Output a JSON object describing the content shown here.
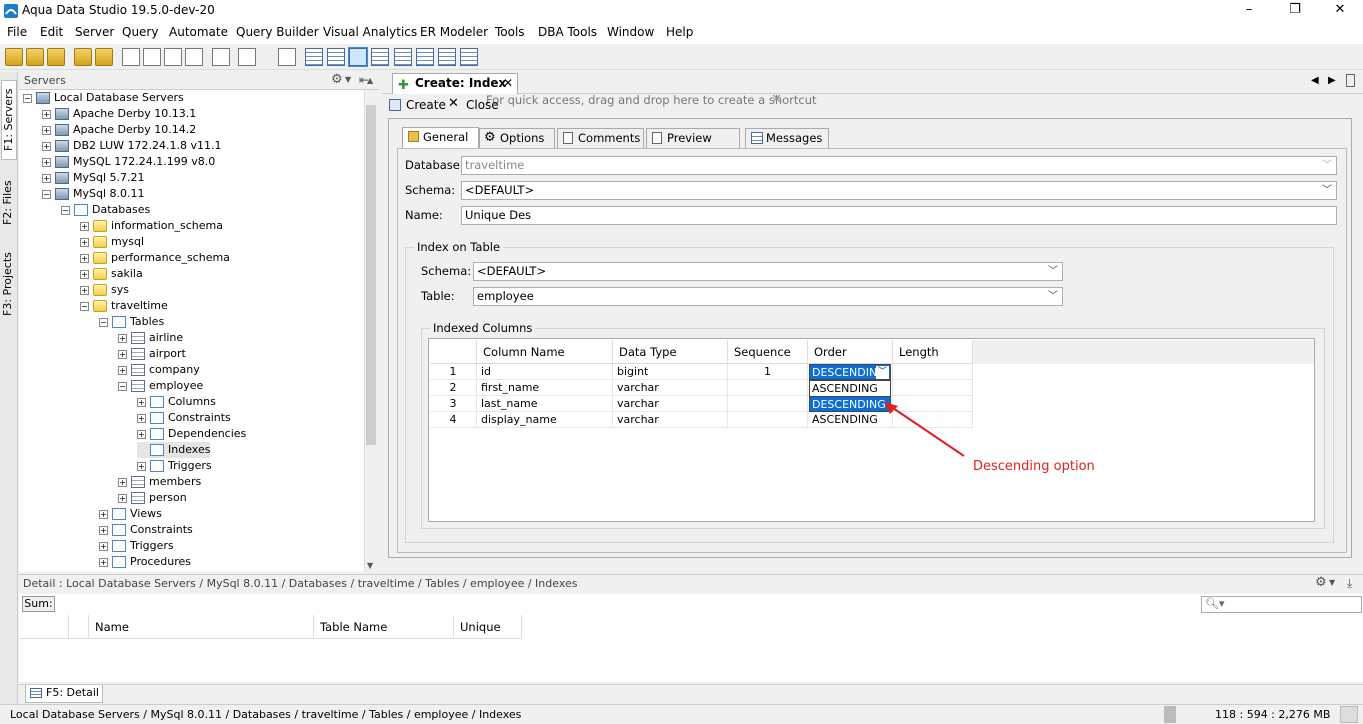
{
  "window": {
    "title": "Aqua Data Studio 19.5.0-dev-20",
    "minimize": "–",
    "maximize": "❐",
    "close": "✕"
  },
  "menu": [
    "File",
    "Edit",
    "Server",
    "Query",
    "Automate",
    "Query Builder",
    "Visual Analytics",
    "ER Modeler",
    "Tools",
    "DBA Tools",
    "Window",
    "Help"
  ],
  "toolbar": {
    "shortcut_hint": "For quick access, drag and drop here to create a shortcut",
    "shortcut_close": "✕"
  },
  "side_tabs": {
    "servers": "F1: Servers",
    "files": "F2: Files",
    "projects": "F3: Projects"
  },
  "servers_panel": {
    "title": "Servers",
    "tree": [
      {
        "label": "Local Database Servers",
        "level": 0,
        "icon": "server-group-icon",
        "expander": "−"
      },
      {
        "label": "Apache Derby 10.13.1",
        "level": 1,
        "icon": "server-icon",
        "expander": "+"
      },
      {
        "label": "Apache Derby 10.14.2",
        "level": 1,
        "icon": "server-icon",
        "expander": "+"
      },
      {
        "label": "DB2 LUW 172.24.1.8 v11.1",
        "level": 1,
        "icon": "server-icon",
        "expander": "+"
      },
      {
        "label": "MySQL 172.24.1.199 v8.0",
        "level": 1,
        "icon": "server-icon",
        "expander": "+"
      },
      {
        "label": "MySql 5.7.21",
        "level": 1,
        "icon": "server-icon",
        "expander": "+"
      },
      {
        "label": "MySql 8.0.11",
        "level": 1,
        "icon": "server-icon",
        "expander": "−"
      },
      {
        "label": "Databases",
        "level": 2,
        "icon": "folder-icon",
        "expander": "−"
      },
      {
        "label": "information_schema",
        "level": 3,
        "icon": "database-icon",
        "expander": "+"
      },
      {
        "label": "mysql",
        "level": 3,
        "icon": "database-icon",
        "expander": "+"
      },
      {
        "label": "performance_schema",
        "level": 3,
        "icon": "database-icon",
        "expander": "+"
      },
      {
        "label": "sakila",
        "level": 3,
        "icon": "database-icon",
        "expander": "+"
      },
      {
        "label": "sys",
        "level": 3,
        "icon": "database-icon",
        "expander": "+"
      },
      {
        "label": "traveltime",
        "level": 3,
        "icon": "database-icon",
        "expander": "−"
      },
      {
        "label": "Tables",
        "level": 4,
        "icon": "folder-icon",
        "expander": "−"
      },
      {
        "label": "airline",
        "level": 5,
        "icon": "table-icon",
        "expander": "+"
      },
      {
        "label": "airport",
        "level": 5,
        "icon": "table-icon",
        "expander": "+"
      },
      {
        "label": "company",
        "level": 5,
        "icon": "table-icon",
        "expander": "+"
      },
      {
        "label": "employee",
        "level": 5,
        "icon": "table-icon",
        "expander": "−"
      },
      {
        "label": "Columns",
        "level": 6,
        "icon": "folder-icon",
        "expander": "+"
      },
      {
        "label": "Constraints",
        "level": 6,
        "icon": "folder-icon",
        "expander": "+"
      },
      {
        "label": "Dependencies",
        "level": 6,
        "icon": "folder-icon",
        "expander": "+"
      },
      {
        "label": "Indexes",
        "level": 6,
        "icon": "folder-icon",
        "expander": "",
        "selected": true
      },
      {
        "label": "Triggers",
        "level": 6,
        "icon": "folder-icon",
        "expander": "+"
      },
      {
        "label": "members",
        "level": 5,
        "icon": "table-icon",
        "expander": "+"
      },
      {
        "label": "person",
        "level": 5,
        "icon": "table-icon",
        "expander": "+"
      },
      {
        "label": "Views",
        "level": 4,
        "icon": "folder-icon",
        "expander": "+"
      },
      {
        "label": "Constraints",
        "level": 4,
        "icon": "folder-icon",
        "expander": "+"
      },
      {
        "label": "Triggers",
        "level": 4,
        "icon": "folder-icon",
        "expander": "+"
      },
      {
        "label": "Procedures",
        "level": 4,
        "icon": "folder-icon",
        "expander": "+"
      }
    ]
  },
  "editor": {
    "tab_title": "Create: Index",
    "tab_close": "✕",
    "create_label": "Create",
    "close_label": "Close",
    "subtabs": [
      "General",
      "Options",
      "Comments",
      "Preview SQL",
      "Messages"
    ],
    "form": {
      "database_label": "Database:",
      "database_value": "traveltime",
      "schema_label": "Schema:",
      "schema_value": "<DEFAULT>",
      "name_label": "Name:",
      "name_value": "Unique Des",
      "index_on_table": "Index on Table",
      "table_schema_label": "Schema:",
      "table_schema_value": "<DEFAULT>",
      "table_label": "Table:",
      "table_value": "employee",
      "indexed_columns": "Indexed Columns"
    },
    "grid": {
      "headers": [
        "Column Name",
        "Data Type",
        "Sequence",
        "Order",
        "Length"
      ],
      "rows": [
        {
          "num": "1",
          "column": "id",
          "type": "bigint",
          "sequence": "1",
          "order": "DESCENDING",
          "length": ""
        },
        {
          "num": "2",
          "column": "first_name",
          "type": "varchar",
          "sequence": "",
          "order": "ASCENDING",
          "length": ""
        },
        {
          "num": "3",
          "column": "last_name",
          "type": "varchar",
          "sequence": "",
          "order": "DESCENDING",
          "length": ""
        },
        {
          "num": "4",
          "column": "display_name",
          "type": "varchar",
          "sequence": "",
          "order": "ASCENDING",
          "length": ""
        }
      ],
      "dropdown_options": [
        "ASCENDING",
        "DESCENDING"
      ]
    },
    "annotation": "Descending option",
    "accent": "#0a6fd6",
    "annotation_color": "#e02020"
  },
  "detail": {
    "path": "Detail : Local Database Servers / MySql 8.0.11 / Databases / traveltime / Tables / employee / Indexes",
    "sum_label": "Sum:",
    "search_placeholder": "",
    "headers": [
      "Name",
      "Table Name",
      "Unique"
    ],
    "tab_label": "F5: Detail"
  },
  "status": {
    "path": "Local Database Servers / MySql 8.0.11 / Databases / traveltime / Tables / employee / Indexes",
    "memory": "118 : 594 : 2,276 MB"
  }
}
